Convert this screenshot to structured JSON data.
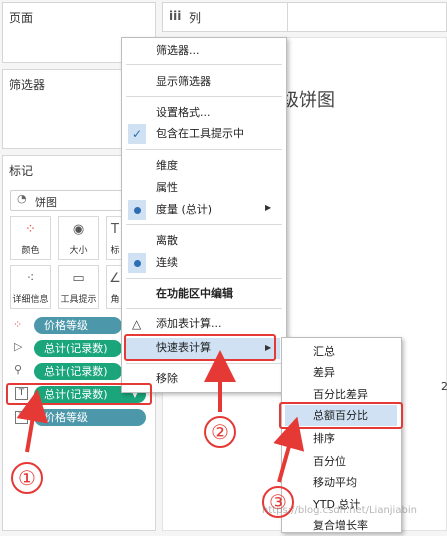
{
  "panels": {
    "pages_title": "页面",
    "filters_title": "筛选器",
    "marks_title": "标记",
    "columns_label": "列",
    "columns_icon": "iii"
  },
  "marks": {
    "mark_type": "饼图",
    "cards": [
      "颜色",
      "大小",
      "标",
      "详细信息",
      "工具提示",
      "角"
    ],
    "pills": [
      "价格等级",
      "总计(记录数)",
      "总计(记录数)",
      "总计(记录数)",
      "价格等级"
    ]
  },
  "sheet_title_partial": "级饼图",
  "edge_digit": "2",
  "context_menu": {
    "filter": "筛选器...",
    "show_filter": "显示筛选器",
    "format": "设置格式...",
    "include_tooltip": "包含在工具提示中",
    "dimension": "维度",
    "attribute": "属性",
    "measure": "度量 (总计)",
    "discrete": "离散",
    "continuous": "连续",
    "edit_shelf": "在功能区中编辑",
    "add_calc": "添加表计算...",
    "quick_calc": "快速表计算",
    "remove": "移除"
  },
  "submenu": [
    "汇总",
    "差异",
    "百分比差异",
    "总额百分比",
    "排序",
    "百分位",
    "移动平均",
    "YTD 总计",
    "复合增长率"
  ],
  "annotations": [
    "①",
    "②",
    "③"
  ],
  "watermark": "https://blog.csdn.net/Lianjiabin",
  "colors": {
    "accent_red": "#e53935",
    "pill_green": "#1aa57b",
    "pill_teal": "#4c98aa",
    "highlight": "#cfe1f3"
  }
}
